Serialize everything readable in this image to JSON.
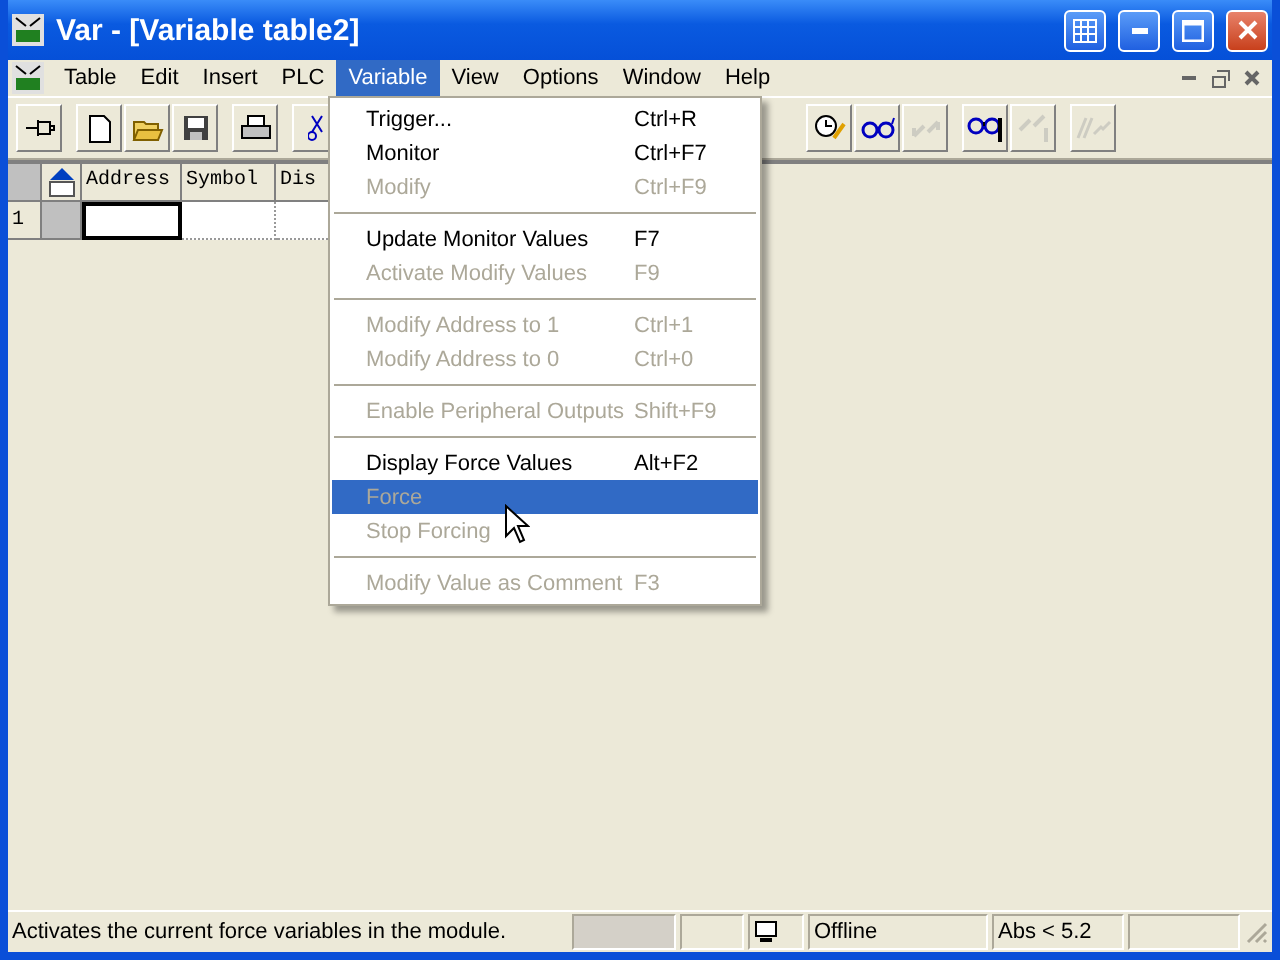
{
  "window": {
    "title": "Var - [Variable table2]"
  },
  "menu": [
    {
      "label": "Table",
      "selected": false
    },
    {
      "label": "Edit",
      "selected": false
    },
    {
      "label": "Insert",
      "selected": false
    },
    {
      "label": "PLC",
      "selected": false
    },
    {
      "label": "Variable",
      "selected": true
    },
    {
      "label": "View",
      "selected": false
    },
    {
      "label": "Options",
      "selected": false
    },
    {
      "label": "Window",
      "selected": false
    },
    {
      "label": "Help",
      "selected": false
    }
  ],
  "toolbar": [
    [
      {
        "kind": "pin",
        "disabled": false
      }
    ],
    [
      {
        "kind": "new",
        "disabled": false
      },
      {
        "kind": "open",
        "disabled": false
      },
      {
        "kind": "save",
        "disabled": false
      }
    ],
    [
      {
        "kind": "print",
        "disabled": false
      }
    ],
    [
      {
        "kind": "cut",
        "disabled": false
      }
    ]
  ],
  "toolbar_right": [
    [
      {
        "kind": "monitor_edit",
        "disabled": false
      },
      {
        "kind": "glasses",
        "disabled": false
      },
      {
        "kind": "modify",
        "disabled": true
      }
    ],
    [
      {
        "kind": "glasses_io",
        "disabled": false
      },
      {
        "kind": "modify_io",
        "disabled": true
      }
    ],
    [
      {
        "kind": "force",
        "disabled": true
      }
    ]
  ],
  "table": {
    "columns": [
      "Address",
      "Symbol",
      "Dis"
    ],
    "rows": [
      {
        "number": "1"
      }
    ]
  },
  "dropdown": [
    {
      "kind": "item",
      "label": "Trigger...",
      "shortcut": "Ctrl+R",
      "disabled": false,
      "selected": false
    },
    {
      "kind": "item",
      "label": "Monitor",
      "shortcut": "Ctrl+F7",
      "disabled": false,
      "selected": false
    },
    {
      "kind": "item",
      "label": "Modify",
      "shortcut": "Ctrl+F9",
      "disabled": true,
      "selected": false
    },
    {
      "kind": "separator"
    },
    {
      "kind": "item",
      "label": "Update Monitor Values",
      "shortcut": "F7",
      "disabled": false,
      "selected": false
    },
    {
      "kind": "item",
      "label": "Activate Modify Values",
      "shortcut": "F9",
      "disabled": true,
      "selected": false
    },
    {
      "kind": "separator"
    },
    {
      "kind": "item",
      "label": "Modify Address to 1",
      "shortcut": "Ctrl+1",
      "disabled": true,
      "selected": false
    },
    {
      "kind": "item",
      "label": "Modify Address to 0",
      "shortcut": "Ctrl+0",
      "disabled": true,
      "selected": false
    },
    {
      "kind": "separator"
    },
    {
      "kind": "item",
      "label": "Enable Peripheral Outputs",
      "shortcut": "Shift+F9",
      "disabled": true,
      "selected": false
    },
    {
      "kind": "separator"
    },
    {
      "kind": "item",
      "label": "Display Force Values",
      "shortcut": "Alt+F2",
      "disabled": false,
      "selected": false
    },
    {
      "kind": "item",
      "label": "Force",
      "disabled": true,
      "selected": true
    },
    {
      "kind": "item",
      "label": "Stop Forcing",
      "disabled": true,
      "selected": false
    },
    {
      "kind": "separator"
    },
    {
      "kind": "item",
      "label": "Modify Value as Comment",
      "shortcut": "F3",
      "disabled": true,
      "selected": false
    }
  ],
  "status_bar": {
    "message": "Activates the current force variables in the module.",
    "connection": "Offline",
    "version": "Abs < 5.2"
  }
}
